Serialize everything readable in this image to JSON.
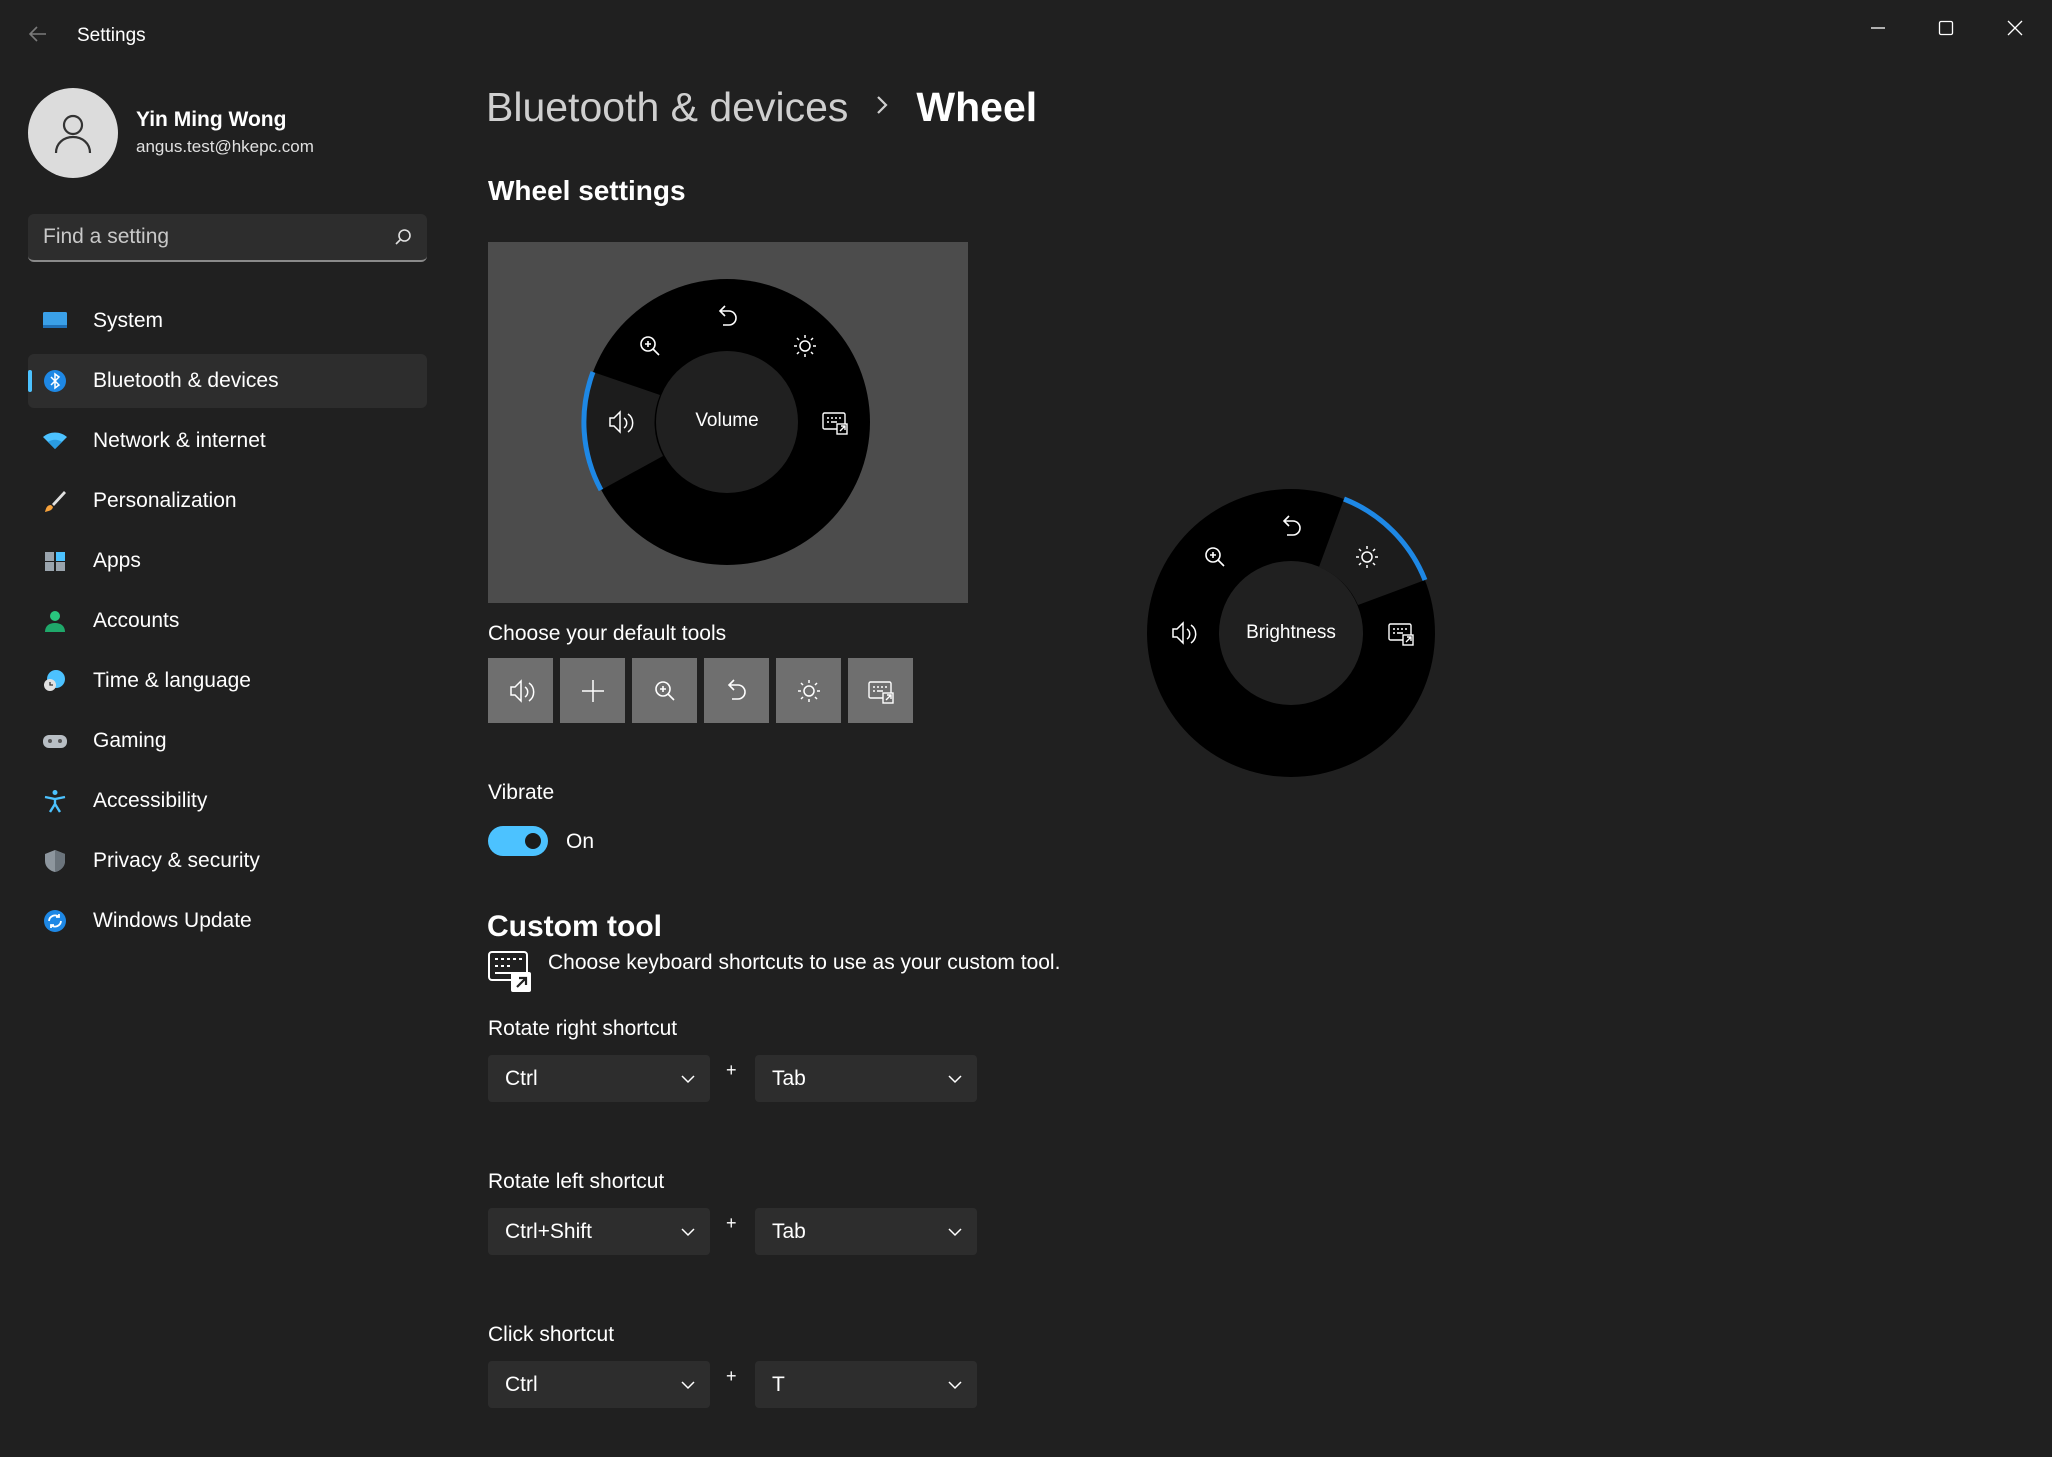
{
  "window": {
    "title": "Settings"
  },
  "profile": {
    "name": "Yin Ming Wong",
    "email": "angus.test@hkepc.com"
  },
  "search": {
    "placeholder": "Find a setting"
  },
  "sidebar": {
    "items": [
      {
        "label": "System",
        "icon": "system-icon"
      },
      {
        "label": "Bluetooth & devices",
        "icon": "bluetooth-icon",
        "active": true
      },
      {
        "label": "Network & internet",
        "icon": "wifi-icon"
      },
      {
        "label": "Personalization",
        "icon": "brush-icon"
      },
      {
        "label": "Apps",
        "icon": "apps-icon"
      },
      {
        "label": "Accounts",
        "icon": "accounts-icon"
      },
      {
        "label": "Time & language",
        "icon": "time-language-icon"
      },
      {
        "label": "Gaming",
        "icon": "gamepad-icon"
      },
      {
        "label": "Accessibility",
        "icon": "accessibility-icon"
      },
      {
        "label": "Privacy & security",
        "icon": "shield-icon"
      },
      {
        "label": "Windows Update",
        "icon": "update-icon"
      }
    ]
  },
  "breadcrumb": {
    "parent": "Bluetooth & devices",
    "current": "Wheel"
  },
  "wheel_settings": {
    "title": "Wheel settings",
    "preview_center_label": "Volume",
    "default_tools_label": "Choose your default tools",
    "tools": [
      "volume-icon",
      "plus-icon",
      "zoom-icon",
      "undo-icon",
      "brightness-icon",
      "keyboard-shortcut-icon"
    ]
  },
  "vibrate": {
    "label": "Vibrate",
    "state_label": "On",
    "on": true
  },
  "custom_tool": {
    "title": "Custom tool",
    "description": "Choose keyboard shortcuts to use as your custom tool.",
    "plus_sign": "+",
    "shortcuts": [
      {
        "label": "Rotate right shortcut",
        "modifier": "Ctrl",
        "key": "Tab"
      },
      {
        "label": "Rotate left shortcut",
        "modifier": "Ctrl+Shift",
        "key": "Tab"
      },
      {
        "label": "Click shortcut",
        "modifier": "Ctrl",
        "key": "T"
      }
    ]
  },
  "wheel_popup": {
    "center_label": "Brightness"
  },
  "colors": {
    "accent": "#4cc2ff",
    "selection_arc": "#1e88e5",
    "background": "#202020",
    "surface": "#2d2d2d"
  }
}
